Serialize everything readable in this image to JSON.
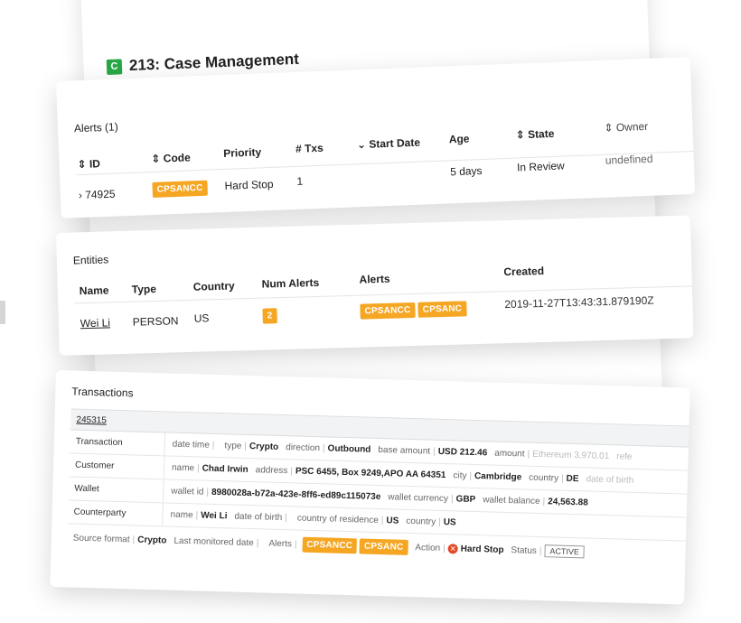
{
  "header": {
    "badge": "C",
    "title": "213: Case Management"
  },
  "alerts": {
    "title": "Alerts (1)",
    "columns": {
      "id": "⇕ ID",
      "code": "⇕ Code",
      "priority": "Priority",
      "txs": "# Txs",
      "start": "⌄ Start Date",
      "age": "Age",
      "state": "⇕ State",
      "owner": "⇕ Owner"
    },
    "row": {
      "id": "› 74925",
      "code": "CPSANCC",
      "priority": "Hard Stop",
      "txs": "1",
      "age": "5 days",
      "state": "In Review",
      "owner": "undefined"
    }
  },
  "entities": {
    "title": "Entities",
    "columns": {
      "name": "Name",
      "type": "Type",
      "country": "Country",
      "num_alerts": "Num Alerts",
      "alerts": "Alerts",
      "created": "Created"
    },
    "row": {
      "name": "Wei Li",
      "type": "PERSON",
      "country": "US",
      "num_alerts": "2",
      "alert1": "CPSANCC",
      "alert2": "CPSANC",
      "created": "2019-11-27T13:43:31.879190Z"
    }
  },
  "transactions": {
    "title": "Transactions",
    "tx_id": "245315",
    "rows": {
      "transaction": {
        "label": "Transaction",
        "date_time_k": "date time",
        "type_k": "type",
        "type_v": "Crypto",
        "direction_k": "direction",
        "direction_v": "Outbound",
        "base_k": "base amount",
        "base_v": "USD 212.46",
        "amount_k": "amount",
        "amount_v": "Ethereum 3,970.01",
        "ref_k": "refe"
      },
      "customer": {
        "label": "Customer",
        "name_k": "name",
        "name_v": "Chad Irwin",
        "address_k": "address",
        "address_v": "PSC 6455, Box 9249,APO AA 64351",
        "city_k": "city",
        "city_v": "Cambridge",
        "country_k": "country",
        "country_v": "DE",
        "dob_k": "date of birth"
      },
      "wallet": {
        "label": "Wallet",
        "id_k": "wallet id",
        "id_v": "8980028a-b72a-423e-8ff6-ed89c115073e",
        "currency_k": "wallet currency",
        "currency_v": "GBP",
        "balance_k": "wallet balance",
        "balance_v": "24,563.88"
      },
      "counterparty": {
        "label": "Counterparty",
        "name_k": "name",
        "name_v": "Wei Li",
        "dob_k": "date of birth",
        "cor_k": "country of residence",
        "cor_v": "US",
        "country_k": "country",
        "country_v": "US"
      },
      "footer": {
        "source_k": "Source format",
        "source_v": "Crypto",
        "monitored_k": "Last monitored date",
        "alerts_k": "Alerts",
        "alert1": "CPSANCC",
        "alert2": "CPSANC",
        "action_k": "Action",
        "action_v": "Hard Stop",
        "status_k": "Status",
        "status_v": "ACTIVE"
      }
    }
  },
  "colors": {
    "accent_tag": "#f5a623",
    "badge_green": "#28a745",
    "stop_red": "#e24b26"
  }
}
